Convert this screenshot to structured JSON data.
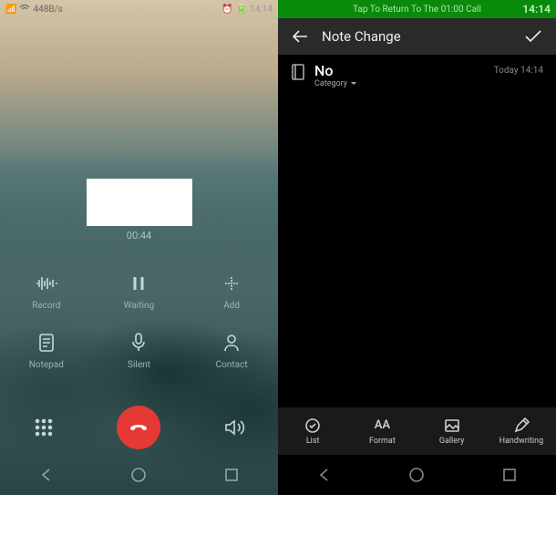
{
  "left": {
    "status": {
      "signal": "448B/s",
      "time": "14:14"
    },
    "timer": "00:44",
    "buttons": {
      "record": "Record",
      "waiting": "Waiting",
      "add": "Add",
      "notepad": "Notepad",
      "silent": "Silent",
      "contact": "Contact"
    }
  },
  "right": {
    "return_bar": "Tap To Return To The 01:00 Call",
    "clock": "14:14",
    "header_title": "Note Change",
    "note_title": "No",
    "category_label": "Category",
    "date": "Today 14:14",
    "toolbar": {
      "list": "List",
      "format": "Format",
      "gallery": "Gallery",
      "handwriting": "Handwriting"
    }
  }
}
